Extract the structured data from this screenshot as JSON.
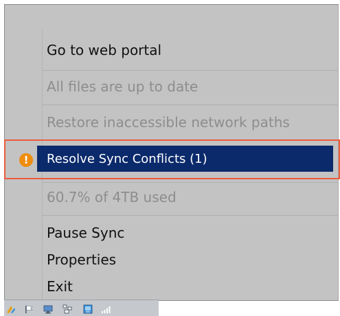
{
  "menu": {
    "go_to_web_portal": "Go to web portal",
    "status": "All files are up to date",
    "restore_paths": "Restore inaccessible network paths",
    "resolve_conflicts": "Resolve Sync Conflicts (1)",
    "usage": "60.7% of 4TB used",
    "pause_sync": "Pause Sync",
    "properties": "Properties",
    "exit": "Exit"
  },
  "icons": {
    "warning": "warning-icon",
    "tray": [
      "sync-tray-icon",
      "flag-icon",
      "monitor-icon",
      "network-icon",
      "display-icon",
      "signal-icon"
    ]
  },
  "colors": {
    "menu_background": "#c3c3c3",
    "highlight": "#0b2a6b",
    "highlight_outline": "#ec5b3b",
    "warning": "#ee8d10",
    "disabled_text": "#8d8d8d"
  }
}
